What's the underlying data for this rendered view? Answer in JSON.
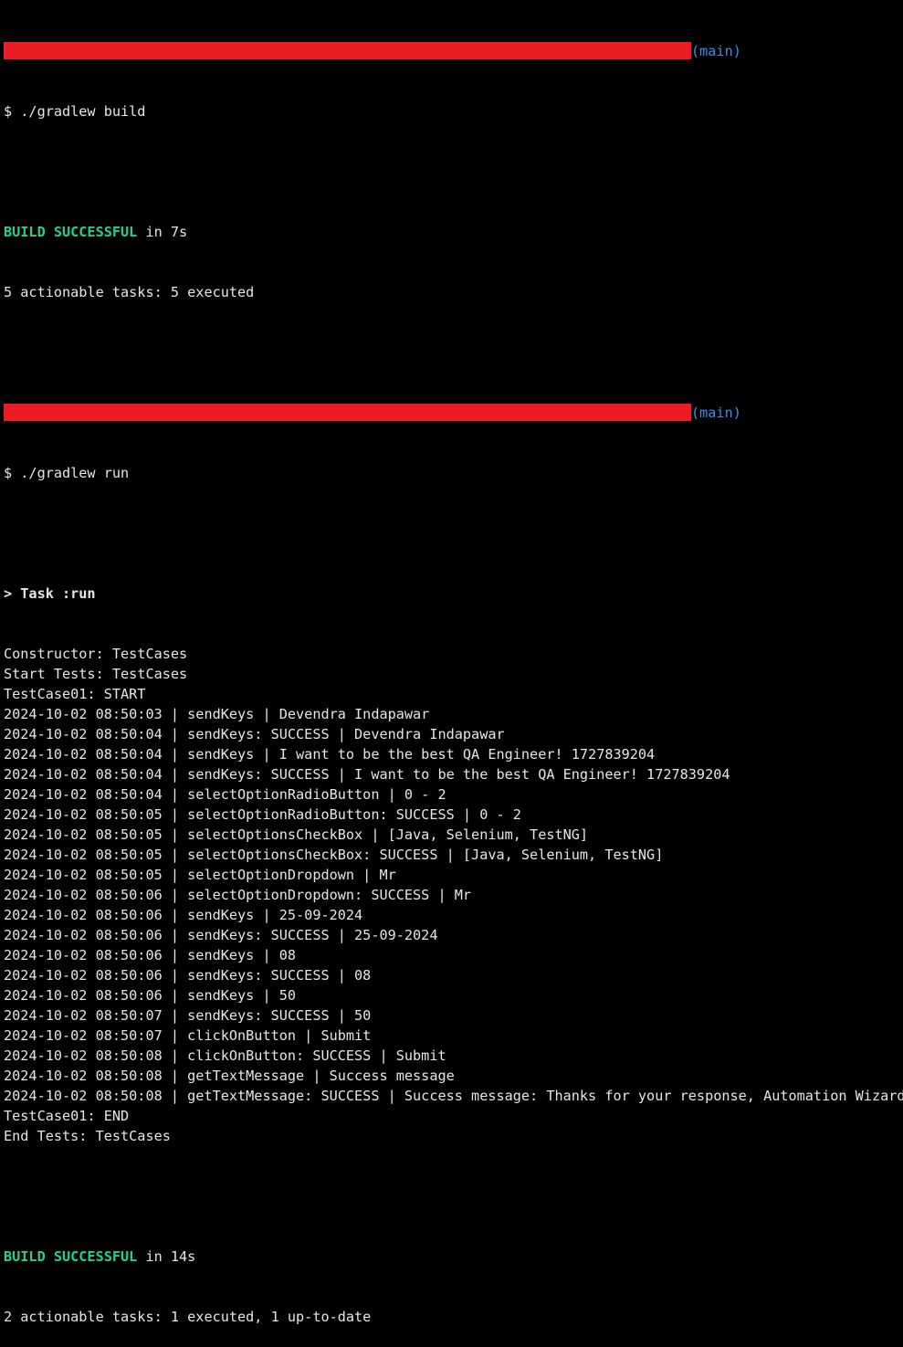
{
  "terminal": {
    "colors": {
      "background": "#000000",
      "text": "#e6e6e6",
      "redaction": "#ec1c24",
      "branch": "#3b8eea",
      "success": "#23d18b"
    },
    "branch": "(main)",
    "build": {
      "command": "$ ./gradlew build",
      "status_word": "BUILD SUCCESSFUL",
      "status_rest": " in 7s",
      "tasks": "5 actionable tasks: 5 executed"
    },
    "run": {
      "command": "$ ./gradlew run",
      "task_header": "> Task :run",
      "log_lines": [
        "Constructor: TestCases",
        "Start Tests: TestCases",
        "TestCase01: START",
        "2024-10-02 08:50:03 | sendKeys | Devendra Indapawar",
        "2024-10-02 08:50:04 | sendKeys: SUCCESS | Devendra Indapawar",
        "2024-10-02 08:50:04 | sendKeys | I want to be the best QA Engineer! 1727839204",
        "2024-10-02 08:50:04 | sendKeys: SUCCESS | I want to be the best QA Engineer! 1727839204",
        "2024-10-02 08:50:04 | selectOptionRadioButton | 0 - 2",
        "2024-10-02 08:50:05 | selectOptionRadioButton: SUCCESS | 0 - 2",
        "2024-10-02 08:50:05 | selectOptionsCheckBox | [Java, Selenium, TestNG]",
        "2024-10-02 08:50:05 | selectOptionsCheckBox: SUCCESS | [Java, Selenium, TestNG]",
        "2024-10-02 08:50:05 | selectOptionDropdown | Mr",
        "2024-10-02 08:50:06 | selectOptionDropdown: SUCCESS | Mr",
        "2024-10-02 08:50:06 | sendKeys | 25-09-2024",
        "2024-10-02 08:50:06 | sendKeys: SUCCESS | 25-09-2024",
        "2024-10-02 08:50:06 | sendKeys | 08",
        "2024-10-02 08:50:06 | sendKeys: SUCCESS | 08",
        "2024-10-02 08:50:06 | sendKeys | 50",
        "2024-10-02 08:50:07 | sendKeys: SUCCESS | 50",
        "2024-10-02 08:50:07 | clickOnButton | Submit",
        "2024-10-02 08:50:08 | clickOnButton: SUCCESS | Submit",
        "2024-10-02 08:50:08 | getTextMessage | Success message",
        "2024-10-02 08:50:08 | getTextMessage: SUCCESS | Success message: Thanks for your response, Automation Wizard!",
        "TestCase01: END",
        "End Tests: TestCases"
      ],
      "status_word": "BUILD SUCCESSFUL",
      "status_rest": " in 14s",
      "tasks": "2 actionable tasks: 1 executed, 1 up-to-date"
    }
  }
}
